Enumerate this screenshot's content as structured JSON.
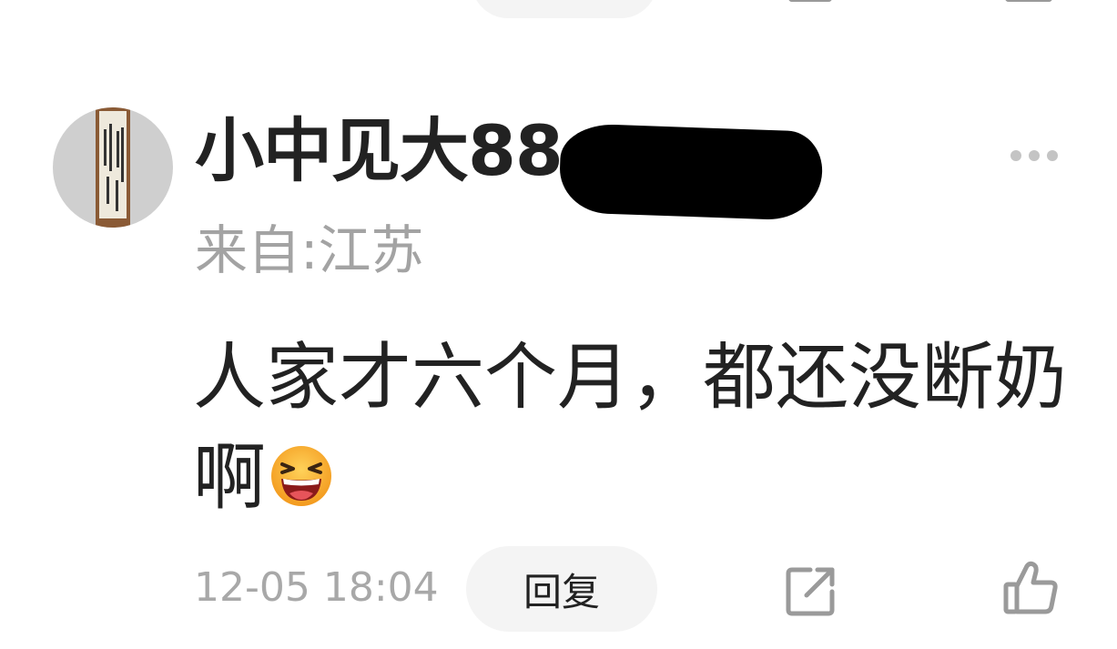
{
  "comment": {
    "username": "小中见大88",
    "location": "来自:江苏",
    "text": "人家才六个月，都还没断奶啊",
    "emoji": "laughing-face-emoji",
    "timestamp": "12-05 18:04",
    "reply_label": "回复",
    "more_icon": "more-dots-icon",
    "share_icon": "share-icon",
    "like_icon": "thumbs-up-icon"
  },
  "colors": {
    "text_primary": "#222222",
    "text_secondary": "#a3a3a3",
    "pill_background": "#f4f4f4",
    "icon_gray": "#9a9a9a"
  }
}
